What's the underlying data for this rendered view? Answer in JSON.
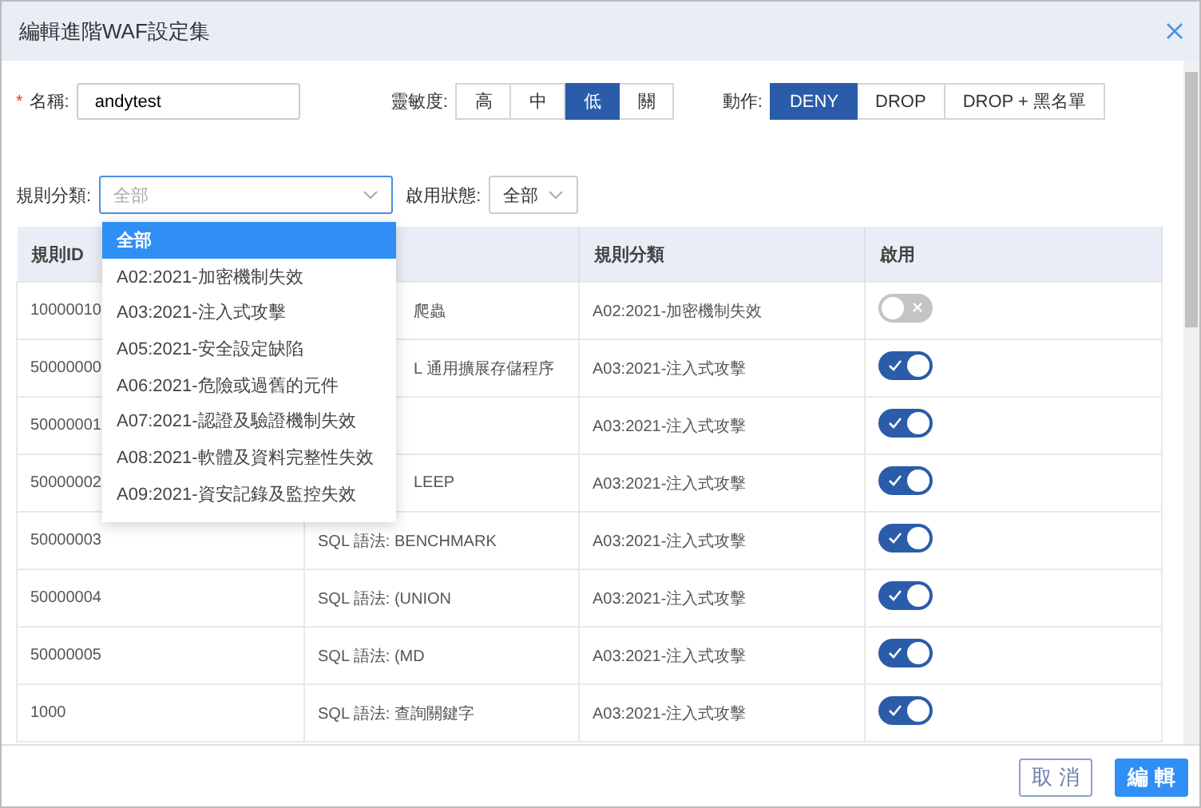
{
  "window": {
    "title": "編輯進階WAF設定集"
  },
  "name_field": {
    "required_mark": "*",
    "label": "名稱:",
    "value": "andytest"
  },
  "sensitivity": {
    "label": "靈敏度:",
    "options": [
      {
        "label": "高",
        "selected": false
      },
      {
        "label": "中",
        "selected": false
      },
      {
        "label": "低",
        "selected": true
      },
      {
        "label": "關",
        "selected": false
      }
    ]
  },
  "action": {
    "label": "動作:",
    "options": [
      {
        "label": "DENY",
        "selected": true
      },
      {
        "label": "DROP",
        "selected": false
      },
      {
        "label": "DROP + 黑名單",
        "selected": false
      }
    ]
  },
  "filters": {
    "category": {
      "label": "規則分類:",
      "placeholder": "全部",
      "expanded": true,
      "options": [
        {
          "label": "全部",
          "selected": true
        },
        {
          "label": "A02:2021-加密機制失效",
          "selected": false
        },
        {
          "label": "A03:2021-注入式攻擊",
          "selected": false
        },
        {
          "label": "A05:2021-安全設定缺陷",
          "selected": false
        },
        {
          "label": "A06:2021-危險或過舊的元件",
          "selected": false
        },
        {
          "label": "A07:2021-認證及驗證機制失效",
          "selected": false
        },
        {
          "label": "A08:2021-軟體及資料完整性失效",
          "selected": false
        },
        {
          "label": "A09:2021-資安記錄及監控失效",
          "selected": false
        }
      ]
    },
    "status": {
      "label": "啟用狀態:",
      "value": "全部"
    }
  },
  "table": {
    "columns": [
      {
        "label": "規則ID"
      },
      {},
      {
        "label": "規則分類"
      },
      {
        "label": "啟用"
      }
    ],
    "rows": [
      {
        "id": "10000010",
        "column_2": "爬蟲",
        "category": "A02:2021-加密機制失效",
        "enabled": false
      },
      {
        "id": "50000000",
        "column_2": "L 通用擴展存儲程序",
        "category": "A03:2021-注入式攻擊",
        "enabled": true
      },
      {
        "id": "50000001",
        "category": "A03:2021-注入式攻擊",
        "enabled": true
      },
      {
        "id": "50000002",
        "column_2": "LEEP",
        "category": "A03:2021-注入式攻擊",
        "enabled": true
      },
      {
        "id": "50000003",
        "column_2": "SQL 語法: BENCHMARK",
        "category": "A03:2021-注入式攻擊",
        "enabled": true
      },
      {
        "id": "50000004",
        "column_2": "SQL 語法: (UNION",
        "category": "A03:2021-注入式攻擊",
        "enabled": true
      },
      {
        "id": "50000005",
        "column_2": "SQL 語法: (MD",
        "category": "A03:2021-注入式攻擊",
        "enabled": true
      },
      {
        "id": "1000",
        "column_2": "SQL 語法: 查詢關鍵字",
        "category": "A03:2021-注入式攻擊",
        "enabled": true
      }
    ]
  },
  "footer": {
    "buttons": [
      {
        "label": "取 消",
        "kind": "secondary"
      },
      {
        "label": "編 輯",
        "kind": "primary"
      }
    ]
  }
}
